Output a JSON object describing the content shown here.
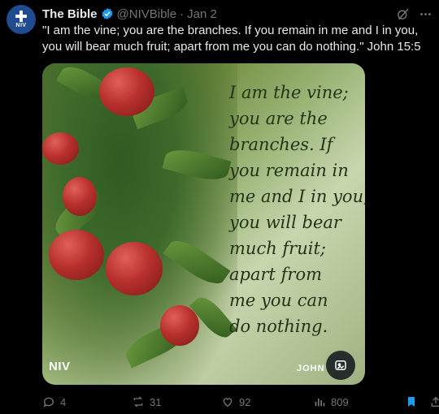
{
  "post": {
    "author_name": "The Bible",
    "handle": "@NIVBible",
    "separator": "·",
    "date": "Jan 2",
    "avatar_text": "NIV",
    "text": "\"I am the vine; you are the branches. If you remain in me and I in you, you will bear much fruit; apart from me you can do nothing.\" John 15:5"
  },
  "media": {
    "quote_lines": [
      "I am the vine;",
      "you are the",
      "branches. If",
      "you remain in",
      "me and I in you,",
      "you will bear",
      "much fruit;",
      "apart from",
      "me you can",
      "do nothing."
    ],
    "logo_text": "NIV",
    "reference_text": "JOHN"
  },
  "actions": {
    "replies": "4",
    "reposts": "31",
    "likes": "92",
    "views": "809"
  },
  "icons": {
    "verified": "verified-badge-icon",
    "grok": "grok-icon",
    "more": "more-icon",
    "reply": "reply-icon",
    "repost": "repost-icon",
    "like": "heart-icon",
    "views": "views-icon",
    "bookmark": "bookmark-icon",
    "share": "share-icon",
    "alt": "image-alt-icon"
  },
  "colors": {
    "background": "#000000",
    "text": "#e7e9ea",
    "muted": "#71767b",
    "accent": "#1d9bf0"
  }
}
